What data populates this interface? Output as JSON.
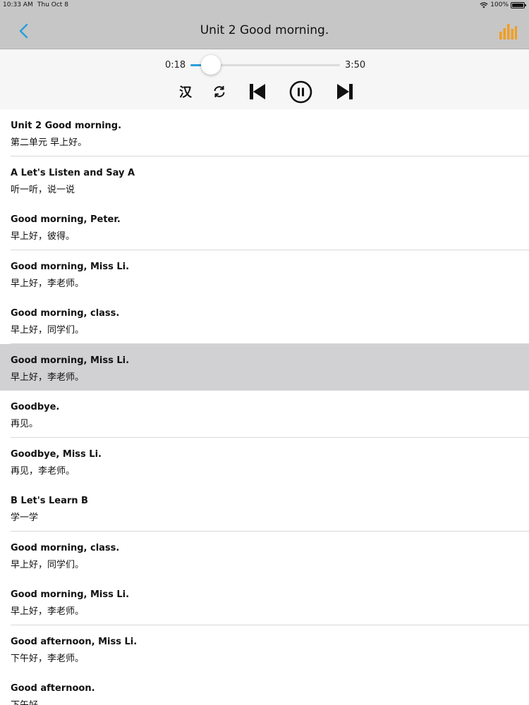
{
  "status": {
    "time": "10:33 AM",
    "date": "Thu Oct 8",
    "battery": "100%"
  },
  "nav": {
    "title": "Unit 2 Good morning.",
    "back_icon": "chevron-left-icon",
    "eq_icon": "equalizer-bars-icon",
    "accent": "#2b9fd9",
    "eq_color": "#f29d1f"
  },
  "player": {
    "current_time": "0:18",
    "total_time": "3:50",
    "progress": 0.078,
    "han_label": "汉",
    "controls": [
      "chinese-toggle",
      "repeat-icon",
      "previous-track-icon",
      "pause-icon",
      "next-track-icon"
    ]
  },
  "sentences": [
    {
      "en": "Unit 2 Good morning.",
      "zh": "第二单元 早上好。"
    },
    {
      "en": "A Let's Listen and Say A",
      "zh": "听一听，说一说"
    },
    {
      "en": "Good morning, Peter.",
      "zh": "早上好，彼得。"
    },
    {
      "en": "Good morning, Miss Li.",
      "zh": "早上好，李老师。"
    },
    {
      "en": "Good morning, class.",
      "zh": "早上好，同学们。"
    },
    {
      "en": "Good morning, Miss Li.",
      "zh": "早上好，李老师。",
      "selected": true
    },
    {
      "en": "Goodbye.",
      "zh": "再见。"
    },
    {
      "en": "Goodbye, Miss Li.",
      "zh": "再见，李老师。"
    },
    {
      "en": "B Let's Learn B",
      "zh": "学一学"
    },
    {
      "en": "Good morning, class.",
      "zh": "早上好，同学们。"
    },
    {
      "en": "Good morning, Miss Li.",
      "zh": "早上好，李老师。"
    },
    {
      "en": "Good afternoon, Miss Li.",
      "zh": "下午好，李老师。"
    },
    {
      "en": "Good afternoon.",
      "zh": "下午好。"
    }
  ]
}
